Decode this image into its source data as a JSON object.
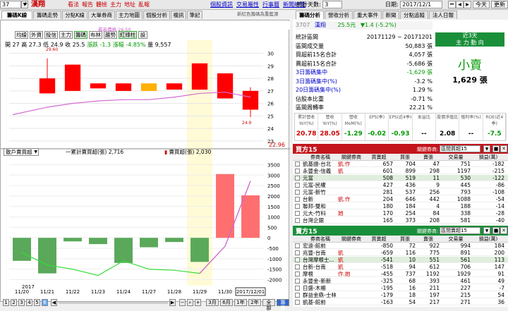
{
  "toolbar": {
    "code": "37",
    "stock": "漢翔",
    "nav": [
      "看法",
      "報告",
      "體檢",
      "主力",
      "地址",
      "亂報"
    ],
    "links": [
      "個股資訊",
      "交易屬性",
      "行事曆",
      "新聞總覽"
    ],
    "days_label": "統計天數:",
    "days_value": "3",
    "date_label": "日期:",
    "date_value": "2017/12/1",
    "today": "今天",
    "refresh": "更新"
  },
  "left_tabs": [
    "籌碼K線",
    "籌碼走勢",
    "分點K線",
    "大單券商",
    "主力地圖",
    "個股分析",
    "複訊",
    "筆記"
  ],
  "left_note": "新紅色籌碼為重藍源",
  "sub_buttons": [
    "均線",
    "外資",
    "投信",
    "主力",
    "籌碼",
    "布林",
    "趨勢",
    "紅綠柱",
    "設"
  ],
  "ohlc_text": "開 27  高 27.3  低 24.9  收 25.5",
  "change_text": "漲跌 -1.3  漲幅 -4.85%",
  "volume_text": "量 9,557",
  "price_max_label": "最高價格 26.50",
  "upper_label_top": "29.60",
  "upper_label_bot": "24.9",
  "right_axis_upper": [
    "30",
    "29",
    "28",
    "27",
    "26",
    "25",
    "24",
    "23"
  ],
  "last_price": "22.96",
  "lower_dropdown": "散戶賣買超",
  "legend1": "一累計賣買超(張) 2,716",
  "legend2": "賣買超(張) 2,030",
  "right_axis_lower": [
    "3500",
    "3000",
    "2500",
    "2000",
    "1500",
    "1000",
    "500",
    "0",
    "-500",
    "-1000",
    "-1500",
    "-2000"
  ],
  "x_dates": [
    "11/20",
    "11/21",
    "11/22",
    "11/23",
    "11/24",
    "11/27",
    "11/28",
    "11/29",
    "11/30",
    "2017/12/01"
  ],
  "x_year": "2017",
  "pages": [
    "1",
    "2",
    "3",
    "4",
    "5",
    "6"
  ],
  "zoom": [
    "3月",
    "6月",
    "1年",
    "2年",
    "全部",
    "籌費"
  ],
  "candles": [
    {
      "date": "11/21",
      "o": 28.0,
      "c": 26.8,
      "h": 29.6,
      "l": 26.8,
      "color": "#ff0000"
    },
    {
      "date": "11/22",
      "o": 29.1,
      "c": 27.0,
      "h": 29.1,
      "l": 27.0,
      "color": "#ff0000"
    },
    {
      "date": "11/23",
      "o": 27.6,
      "c": 27.2,
      "h": 27.6,
      "l": 27.2,
      "color": "#ff0000"
    },
    {
      "date": "11/24",
      "o": 27.6,
      "c": 27.0,
      "h": 27.6,
      "l": 27.0,
      "color": "#ff0000"
    },
    {
      "date": "11/27",
      "o": 27.6,
      "c": 27.0,
      "h": 27.6,
      "l": 27.0,
      "color": "#ffb000"
    },
    {
      "date": "11/28",
      "o": 27.6,
      "c": 27.1,
      "h": 27.6,
      "l": 27.1,
      "color": "#ff0000"
    },
    {
      "date": "11/29",
      "o": 29.2,
      "c": 27.1,
      "h": 29.2,
      "l": 27.1,
      "color": "#ff0000"
    },
    {
      "date": "11/30",
      "o": 28.4,
      "c": 26.4,
      "h": 28.4,
      "l": 26.4,
      "color": "#ff0000"
    },
    {
      "date": "12/01",
      "o": 27.0,
      "c": 25.5,
      "h": 27.3,
      "l": 24.9,
      "color": "#ff0000"
    }
  ],
  "ma_line": [
    25.1,
    25.7,
    26.0,
    26.2,
    26.3,
    26.3,
    26.5,
    26.8,
    26.9,
    26.5
  ],
  "bars_lower": [
    -1100,
    -1700,
    -170,
    -300,
    -1200,
    -450,
    -200,
    -1150,
    3050,
    2030
  ],
  "cum_line": [
    -700,
    -1300,
    -1500,
    -1800,
    -1100,
    -1500,
    -1550,
    -1700,
    -400,
    2716
  ],
  "right_tabs": [
    "籌碼分析",
    "營收分析",
    "重大事件",
    "新聞",
    "分點追蹤",
    "法人日報"
  ],
  "summary": {
    "code": "3707",
    "name": "漢翔",
    "price": "25.5元",
    "change": "▼1.4 (-5.2%)",
    "badge1": "近3天",
    "badge2": "主 力 動 向",
    "big": "小賣",
    "big_val": "1,629 張",
    "rows": [
      {
        "label": "統計區間",
        "value": "20171129 ~ 20171201"
      },
      {
        "label": "區間成交量",
        "value": "50,883 張"
      },
      {
        "label": "買超前15名合計",
        "value": "4,057 張"
      },
      {
        "label": "賣超前15名合計",
        "value": "-5,686 張"
      },
      {
        "label": "3日籌碼集中",
        "value": "-1,629 張"
      },
      {
        "label": "3日籌碼集中(%)",
        "value": "-3.2 %"
      },
      {
        "label": "20日籌碼集中(%)",
        "value": "1.29 %"
      },
      {
        "label": "佔股本比重",
        "value": "-0.71 %"
      },
      {
        "label": "區間周轉率",
        "value": "22.21 %"
      }
    ]
  },
  "metrics": {
    "headers": [
      "累計營收YoY(%)",
      "營收YoY(%)",
      "營收MoM(%)",
      "EPS(季)",
      "EPS(近4季)",
      "本益比",
      "股價淨值比",
      "殖利率(%)",
      "ROE(近4季)"
    ],
    "values": [
      "20.78",
      "28.05",
      "-1.29",
      "-0.02",
      "-0.93",
      "--",
      "2.08",
      "--",
      "-7.5"
    ]
  },
  "buy_panel": {
    "title": "買方15",
    "filter_label": "關鍵券商:",
    "filter_val": "區間買超15",
    "headers": [
      "券商名稱",
      "關鍵券商",
      "買賣超",
      "買張",
      "賣張",
      "交易量",
      "損益(萬)"
    ],
    "rows": [
      [
        "凱基證-台北",
        "凱.作",
        "657",
        "704",
        "47",
        "751",
        "-182"
      ],
      [
        "永豐金-信義",
        "凱",
        "601",
        "899",
        "298",
        "1197",
        "-215"
      ],
      [
        "元富",
        "",
        "508",
        "519",
        "11",
        "530",
        "-122"
      ],
      [
        "元富-民權",
        "",
        "427",
        "436",
        "9",
        "445",
        "-86"
      ],
      [
        "元富-新竹",
        "",
        "281",
        "537",
        "256",
        "793",
        "-108"
      ],
      [
        "台新",
        "凱.作",
        "204",
        "646",
        "442",
        "1088",
        "-54"
      ],
      [
        "聯邦-雙和",
        "",
        "180",
        "184",
        "4",
        "188",
        "-14"
      ],
      [
        "元大-竹科",
        "她",
        "170",
        "254",
        "84",
        "338",
        "-28"
      ],
      [
        "台灣企銀",
        "",
        "165",
        "373",
        "208",
        "581",
        "-40"
      ]
    ]
  },
  "sell_panel": {
    "title": "賣方15",
    "filter_label": "關鍵券商:",
    "filter_val": "區間賣超15",
    "headers": [
      "券商名稱",
      "關鍵券商",
      "買賣超",
      "買張",
      "賣張",
      "交易量",
      "損益(萬)"
    ],
    "rows": [
      [
        "宏遠-館前",
        "",
        "-850",
        "72",
        "922",
        "994",
        "184"
      ],
      [
        "兆豐-台南",
        "凱",
        "-659",
        "116",
        "775",
        "891",
        "200"
      ],
      [
        "台灣摩根士...",
        "凱",
        "-541",
        "10",
        "551",
        "561",
        "113"
      ],
      [
        "台新-台南",
        "凱",
        "-518",
        "94",
        "612",
        "706",
        "147"
      ],
      [
        "摩根",
        "作.她",
        "-455",
        "737",
        "1192",
        "1929",
        "91"
      ],
      [
        "永豐金-新新",
        "",
        "-325",
        "68",
        "393",
        "461",
        "49"
      ],
      [
        "日盛-木柵",
        "",
        "-195",
        "16",
        "211",
        "227",
        "-7"
      ],
      [
        "群益金鼎-士林",
        "",
        "-179",
        "18",
        "197",
        "215",
        "54"
      ],
      [
        "凱基-館前",
        "",
        "-163",
        "54",
        "217",
        "271",
        "36"
      ]
    ]
  }
}
